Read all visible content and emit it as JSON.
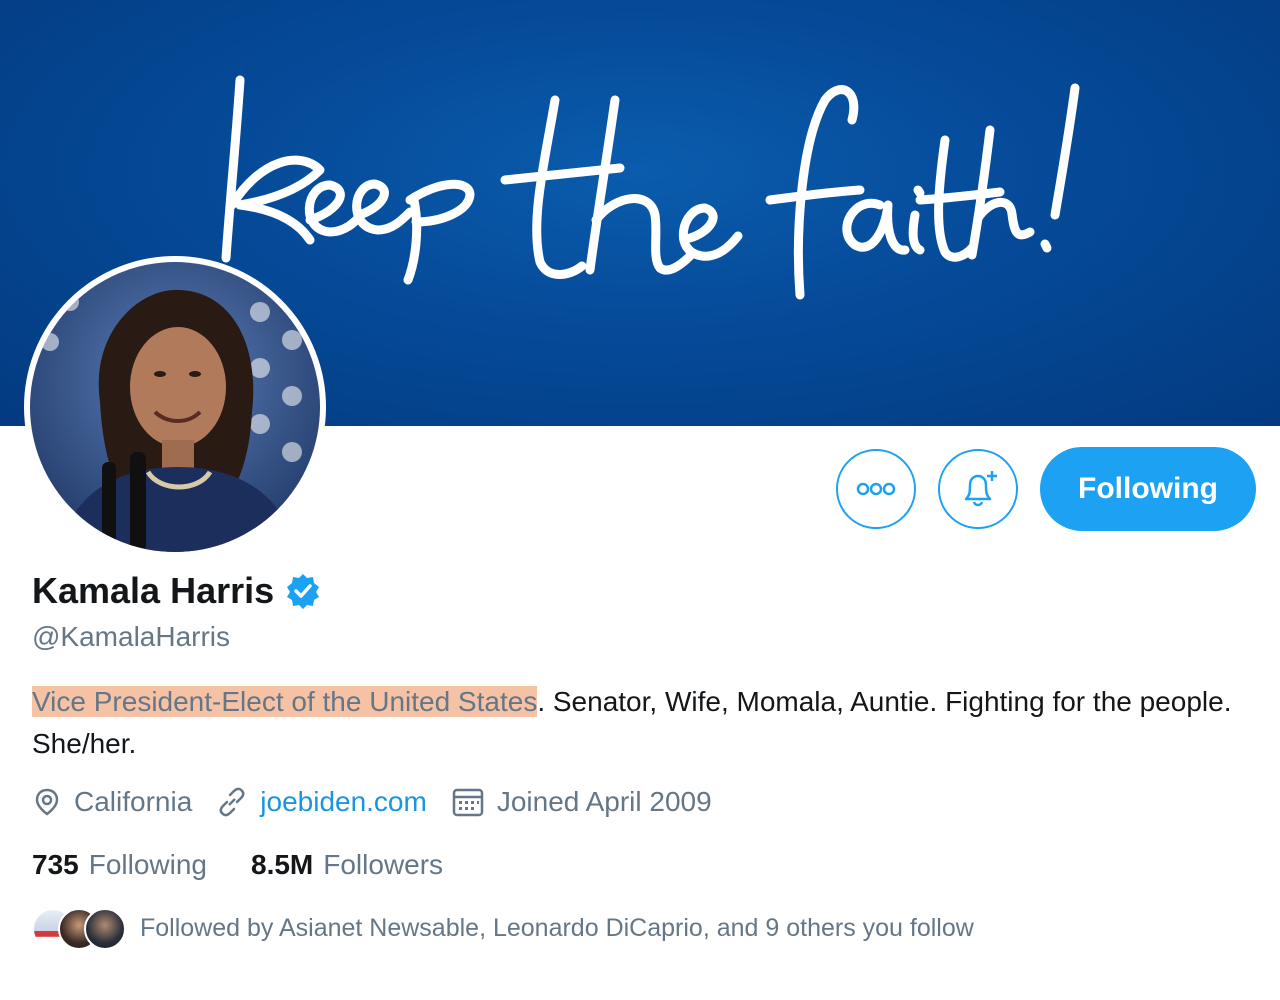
{
  "banner": {
    "script_text": "keep the faith!"
  },
  "profile": {
    "name": "Kamala Harris",
    "handle": "@KamalaHarris",
    "bio_highlight": "Vice President-Elect of the United States",
    "bio_rest": ". Senator, Wife, Momala, Auntie. Fighting for the people. She/her.",
    "location": "California",
    "website": "joebiden.com",
    "joined": "Joined April 2009",
    "following_count": "735",
    "following_label": "Following",
    "followers_count": "8.5M",
    "followers_label": "Followers",
    "followed_by": "Followed by Asianet Newsable, Leonardo DiCaprio, and 9 others you follow"
  },
  "actions": {
    "follow_label": "Following"
  },
  "colors": {
    "accent": "#1da1f2",
    "banner": "#054a98",
    "link": "#1b95e0",
    "highlight": "#f6c2a6"
  },
  "icons": [
    "more-icon",
    "bell-plus-icon",
    "verified-badge-icon",
    "location-icon",
    "link-icon",
    "calendar-icon"
  ]
}
